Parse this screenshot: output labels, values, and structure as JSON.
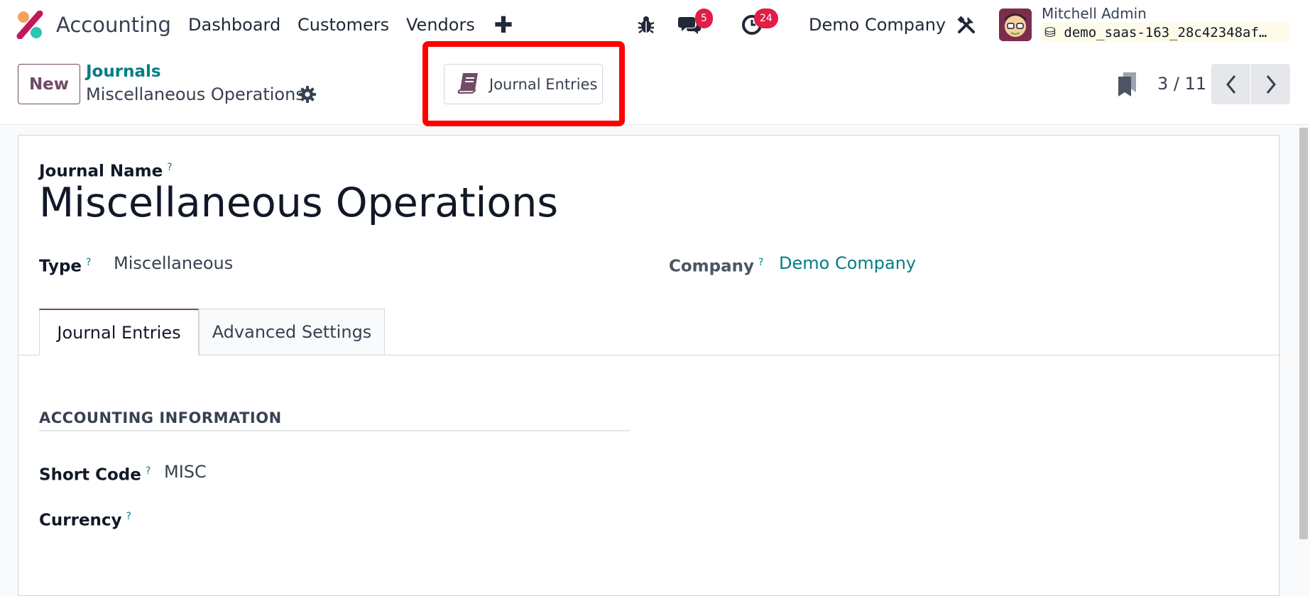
{
  "navbar": {
    "app_name": "Accounting",
    "menu": [
      "Dashboard",
      "Customers",
      "Vendors"
    ],
    "messages_count": "5",
    "activities_count": "24",
    "company": "Demo Company",
    "user_name": "Mitchell Admin",
    "database": "demo_saas-163_28c42348af…"
  },
  "control_panel": {
    "new_label": "New",
    "breadcrumb_parent": "Journals",
    "breadcrumb_current": "Miscellaneous Operations",
    "smart_button_label": "Journal Entries",
    "pager": "3 / 11"
  },
  "form": {
    "journal_name_label": "Journal Name",
    "help_mark": "?",
    "journal_name": "Miscellaneous Operations",
    "type_label": "Type",
    "type_value": "Miscellaneous",
    "company_label": "Company",
    "company_value": "Demo Company",
    "tabs": [
      "Journal Entries",
      "Advanced Settings"
    ],
    "section_title": "ACCOUNTING INFORMATION",
    "short_code_label": "Short Code",
    "short_code_value": "MISC",
    "currency_label": "Currency"
  },
  "colors": {
    "brand": "#714b67",
    "link": "#017e84",
    "badge": "#e11d48",
    "highlight": "#ff0000"
  }
}
